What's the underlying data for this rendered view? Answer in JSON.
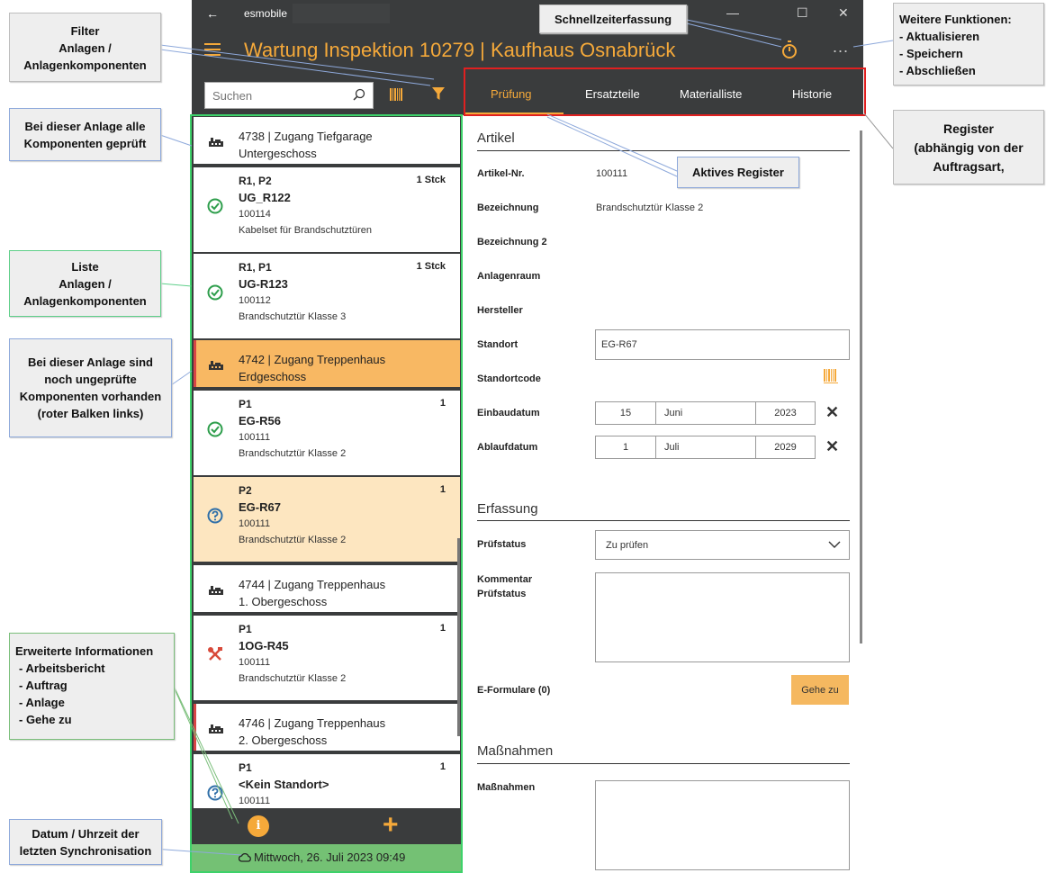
{
  "titlebar": {
    "back_icon": "back-arrow-icon",
    "app_title": "esmobile",
    "minimize": "—",
    "maximize": "☐",
    "close": "✕"
  },
  "header": {
    "title": "Wartung Inspektion 10279  |  Kaufhaus Osnabrück",
    "more": "..."
  },
  "toolbar": {
    "search_placeholder": "Suchen"
  },
  "list": {
    "groups": [
      {
        "text1": "4738  |  Zugang Tiefgarage",
        "text2": "Untergeschoss"
      },
      {
        "text1": "4742  |  Zugang Treppenhaus",
        "text2": "Erdgeschoss"
      },
      {
        "text1": "4744  |  Zugang Treppenhaus",
        "text2": "1. Obergeschoss"
      },
      {
        "text1": "4746  |  Zugang Treppenhaus",
        "text2": "2. Obergeschoss"
      }
    ],
    "items": [
      {
        "pos": "R1, P2",
        "qty": "1 Stck",
        "code": "UG_R122",
        "num": "100114",
        "desc": "Kabelset für Brandschutztüren"
      },
      {
        "pos": "R1, P1",
        "qty": "1 Stck",
        "code": "UG-R123",
        "num": "100112",
        "desc": "Brandschutztür Klasse 3"
      },
      {
        "pos": "P1",
        "qty": "1",
        "code": "EG-R56",
        "num": "100111",
        "desc": "Brandschutztür Klasse 2"
      },
      {
        "pos": "P2",
        "qty": "1",
        "code": "EG-R67",
        "num": "100111",
        "desc": "Brandschutztür Klasse 2"
      },
      {
        "pos": "P1",
        "qty": "1",
        "code": "1OG-R45",
        "num": "100111",
        "desc": "Brandschutztür Klasse 2"
      },
      {
        "pos": "P1",
        "qty": "1",
        "code": "<Kein Standort>",
        "num": "100111",
        "desc": ""
      }
    ]
  },
  "bottombar": {
    "info": "i",
    "plus": "+"
  },
  "sync": {
    "text": "Mittwoch, 26. Juli 2023 09:49"
  },
  "tabs": [
    "Prüfung",
    "Ersatzteile",
    "Materialliste",
    "Historie"
  ],
  "artikel": {
    "section": "Artikel",
    "labels": {
      "artikelnr": "Artikel-Nr.",
      "bez": "Bezeichnung",
      "bez2": "Bezeichnung 2",
      "raum": "Anlagenraum",
      "hersteller": "Hersteller",
      "standort": "Standort",
      "standortcode": "Standortcode",
      "einbau": "Einbaudatum",
      "ablauf": "Ablaufdatum"
    },
    "values": {
      "artikelnr": "100111",
      "bez": "Brandschutztür Klasse 2",
      "standort": "EG-R67"
    },
    "einbau": {
      "day": "15",
      "month": "Juni",
      "year": "2023"
    },
    "ablauf": {
      "day": "1",
      "month": "Juli",
      "year": "2029"
    }
  },
  "erfassung": {
    "section": "Erfassung",
    "pruefstatus_label": "Prüfstatus",
    "pruefstatus_value": "Zu prüfen",
    "kommentar_label1": "Kommentar",
    "kommentar_label2": "Prüfstatus",
    "eformulare_label": "E-Formulare (0)",
    "gehezu": "Gehe zu"
  },
  "massnahmen": {
    "section": "Maßnahmen",
    "label": "Maßnahmen"
  },
  "annotations": {
    "filter": [
      "Filter",
      "Anlagen /",
      "Anlagenkomponenten"
    ],
    "alle_geprueft": [
      "Bei dieser Anlage alle",
      "Komponenten geprüft"
    ],
    "liste": [
      "Liste",
      "Anlagen /",
      "Anlagenkomponenten"
    ],
    "ungeprueft": [
      "Bei dieser Anlage sind",
      "noch ungeprüfte",
      "Komponenten vorhanden",
      "(roter Balken links)"
    ],
    "erweitert": [
      "Erweiterte Informationen",
      "- Arbeitsbericht",
      "- Auftrag",
      "- Anlage",
      "- Gehe zu"
    ],
    "datum": [
      "Datum / Uhrzeit der",
      "letzten Synchronisation"
    ],
    "schnell": [
      "Schnellzeiterfassung"
    ],
    "weitere": [
      "Weitere Funktionen:",
      "- Aktualisieren",
      "- Speichern",
      "- Abschließen"
    ],
    "register": [
      "Register",
      "(abhängig von der",
      "Auftragsart,"
    ],
    "aktiv": [
      "Aktives Register"
    ]
  },
  "colors": {
    "accent": "#f5a93a",
    "header": "#3a3c3d",
    "selected_row": "#fde6c0",
    "group_selected": "#f8b863",
    "sync": "#74c174",
    "unchecked_bar": "#d64545",
    "ok_green": "#2e9e4c",
    "question_blue": "#2f6fa8",
    "tool_red": "#d84a3a"
  },
  "icons": {
    "ok": "check-circle-icon",
    "question": "question-circle-icon",
    "tool": "wrench-screwdriver-icon",
    "group": "system-icon",
    "barcode": "barcode-icon",
    "filter": "filter-funnel-icon",
    "timer": "stopwatch-icon",
    "search": "search-icon",
    "cloud": "cloud-sync-icon"
  }
}
